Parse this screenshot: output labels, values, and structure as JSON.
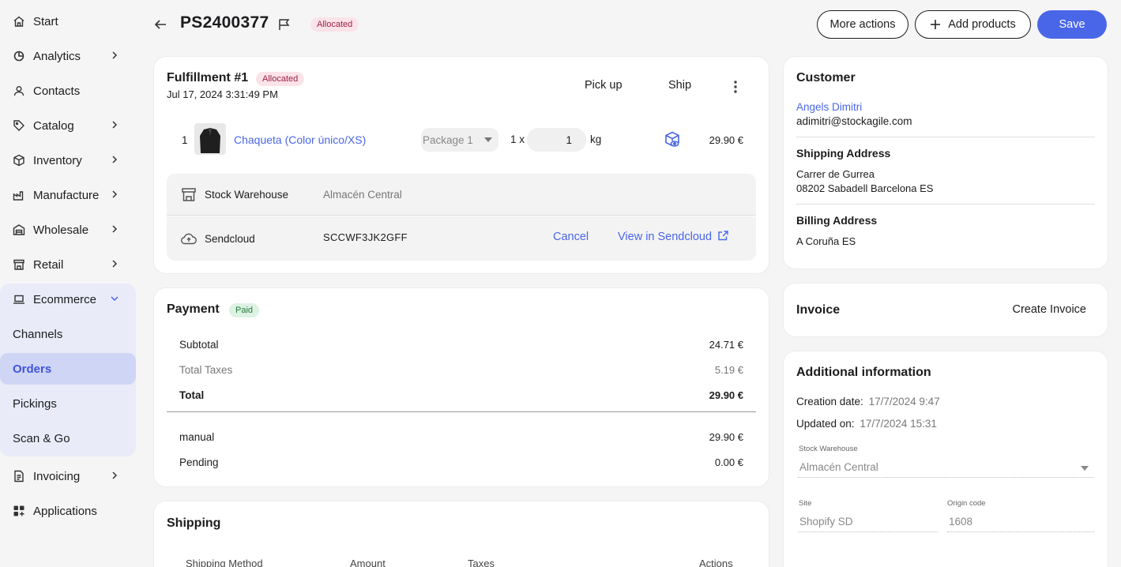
{
  "sidebar": {
    "items": [
      {
        "label": "Start",
        "icon": "home-icon"
      },
      {
        "label": "Analytics",
        "icon": "analytics-icon"
      },
      {
        "label": "Contacts",
        "icon": "user-icon"
      },
      {
        "label": "Catalog",
        "icon": "tag-icon"
      },
      {
        "label": "Inventory",
        "icon": "box-icon"
      },
      {
        "label": "Manufacture",
        "icon": "factory-icon"
      },
      {
        "label": "Wholesale",
        "icon": "warehouse-icon"
      },
      {
        "label": "Retail",
        "icon": "store-icon"
      },
      {
        "label": "Ecommerce",
        "icon": "laptop-icon"
      },
      {
        "label": "Invoicing",
        "icon": "invoice-icon"
      },
      {
        "label": "Applications",
        "icon": "apps-icon"
      }
    ],
    "ecommerce_sub": [
      "Channels",
      "Orders",
      "Pickings",
      "Scan & Go"
    ]
  },
  "header": {
    "order_id": "PS2400377",
    "status": "Allocated",
    "more_actions": "More actions",
    "add_products": "Add products",
    "save": "Save"
  },
  "fulfillment": {
    "title": "Fulfillment #1",
    "badge": "Allocated",
    "date": "Jul 17, 2024 3:31:49 PM",
    "pick_up": "Pick up",
    "ship": "Ship",
    "line": {
      "qty": "1",
      "product": "Chaqueta (Color único/XS)",
      "package": "Package 1",
      "times": "1 x",
      "weight": "1",
      "unit": "kg",
      "price": "29.90 €"
    },
    "warehouse_label": "Stock Warehouse",
    "warehouse_value": "Almacén Central",
    "carrier_label": "Sendcloud",
    "tracking": "SCCWF3JK2GFF",
    "cancel": "Cancel",
    "view": "View in Sendcloud"
  },
  "payment": {
    "title": "Payment",
    "badge": "Paid",
    "subtotal_label": "Subtotal",
    "subtotal": "24.71 €",
    "taxes_label": "Total Taxes",
    "taxes": "5.19 €",
    "total_label": "Total",
    "total": "29.90 €",
    "method_label": "manual",
    "method_amount": "29.90 €",
    "pending_label": "Pending",
    "pending": "0.00 €"
  },
  "shipping": {
    "title": "Shipping",
    "columns": [
      "Shipping Method",
      "Amount",
      "Taxes",
      "Actions"
    ]
  },
  "customer": {
    "title": "Customer",
    "name": "Angels Dimitri",
    "email": "adimitri@stockagile.com",
    "shipping_title": "Shipping Address",
    "shipping_line1": "Carrer de Gurrea",
    "shipping_line2": "08202 Sabadell Barcelona ES",
    "billing_title": "Billing Address",
    "billing_line1": "A Coruña ES"
  },
  "invoice": {
    "title": "Invoice",
    "create": "Create Invoice"
  },
  "additional": {
    "title": "Additional information",
    "creation_label": "Creation date:",
    "creation_value": "17/7/2024 9:47",
    "updated_label": "Updated on:",
    "updated_value": "17/7/2024 15:31",
    "warehouse_label": "Stock Warehouse",
    "warehouse_value": "Almacén Central",
    "site_label": "Site",
    "site_value": "Shopify SD",
    "origin_label": "Origin code",
    "origin_value": "1608"
  },
  "colors": {
    "accent": "#4a66e8",
    "allocated_bg": "#fbe3ea",
    "paid_bg": "#ddf2e3"
  }
}
